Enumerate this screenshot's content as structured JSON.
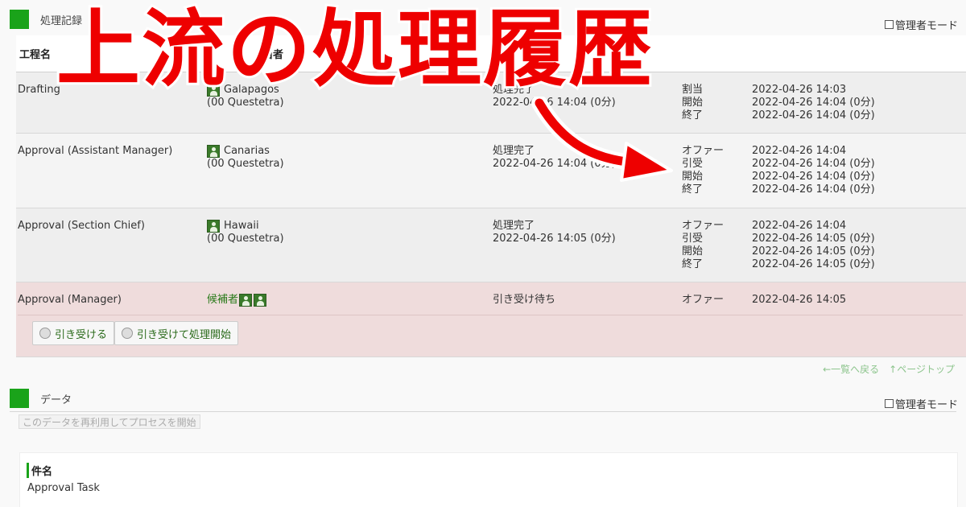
{
  "header": {
    "section_title": "処理記録",
    "admin_mode": "管理者モード"
  },
  "table": {
    "col_step": "工程名",
    "col_user_partial": "当者",
    "rows": [
      {
        "step": "Drafting",
        "user": "Galapagos",
        "org": "(00 Questetra)",
        "status": "処理完了",
        "status_time": "2022-04-26 14:04 (0分)",
        "events": [
          "割当",
          "開始",
          "終了"
        ],
        "times": [
          "2022-04-26 14:03",
          "2022-04-26 14:04 (0分)",
          "2022-04-26 14:04 (0分)"
        ]
      },
      {
        "step": "Approval (Assistant Manager)",
        "user": "Canarias",
        "org": "(00 Questetra)",
        "status": "処理完了",
        "status_time": "2022-04-26 14:04 (0分)",
        "events": [
          "オファー",
          "引受",
          "開始",
          "終了"
        ],
        "times": [
          "2022-04-26 14:04",
          "2022-04-26 14:04 (0分)",
          "2022-04-26 14:04 (0分)",
          "2022-04-26 14:04 (0分)"
        ]
      },
      {
        "step": "Approval (Section Chief)",
        "user": "Hawaii",
        "org": "(00 Questetra)",
        "status": "処理完了",
        "status_time": "2022-04-26 14:05 (0分)",
        "events": [
          "オファー",
          "引受",
          "開始",
          "終了"
        ],
        "times": [
          "2022-04-26 14:04",
          "2022-04-26 14:05 (0分)",
          "2022-04-26 14:05 (0分)",
          "2022-04-26 14:05 (0分)"
        ]
      },
      {
        "step": "Approval (Manager)",
        "candidates_label": "候補者",
        "status": "引き受け待ち",
        "events": [
          "オファー"
        ],
        "times": [
          "2022-04-26 14:05"
        ]
      }
    ],
    "accept_button": "引き受ける",
    "accept_start_button": "引き受けて処理開始"
  },
  "links": {
    "back_to_list": "←一覧へ戻る",
    "page_top": "↑ページトップ"
  },
  "data_section": {
    "title": "データ",
    "admin_mode": "管理者モード",
    "reuse_button": "このデータを再利用してプロセスを開始",
    "field_label": "件名",
    "field_value": "Approval Task"
  },
  "overlay": {
    "title": "上流の処理履歴",
    "color": "#ee0000"
  },
  "colors": {
    "accent_green": "#1aa31a",
    "pending_row": "#efdcdc"
  }
}
